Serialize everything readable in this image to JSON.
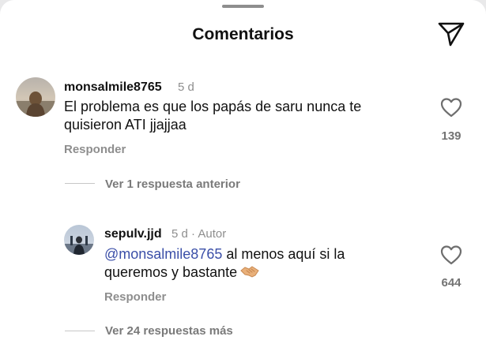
{
  "header": {
    "title": "Comentarios",
    "share_icon": "paper-plane-icon"
  },
  "comments": [
    {
      "username": "monsalmile8765",
      "time": "5 d",
      "text_lines": [
        "El problema es que los papás de saru nunca te",
        "quisieron ATI jjajjaa"
      ],
      "reply_label": "Responder",
      "likes": "139",
      "like_icon": "heart-icon",
      "view_replies": "Ver 1 respuesta anterior"
    },
    {
      "username": "sepulv.jjd",
      "time": "5 d",
      "separator": "·",
      "author_tag": "Autor",
      "mention": "@monsalmile8765",
      "text_line1_rest": " al menos aquí si la",
      "text_line2": "queremos y bastante",
      "emoji_icon": "handshake-emoji-icon",
      "reply_label": "Responder",
      "likes": "644",
      "like_icon": "heart-icon",
      "view_replies": "Ver 24 respuestas más"
    }
  ]
}
